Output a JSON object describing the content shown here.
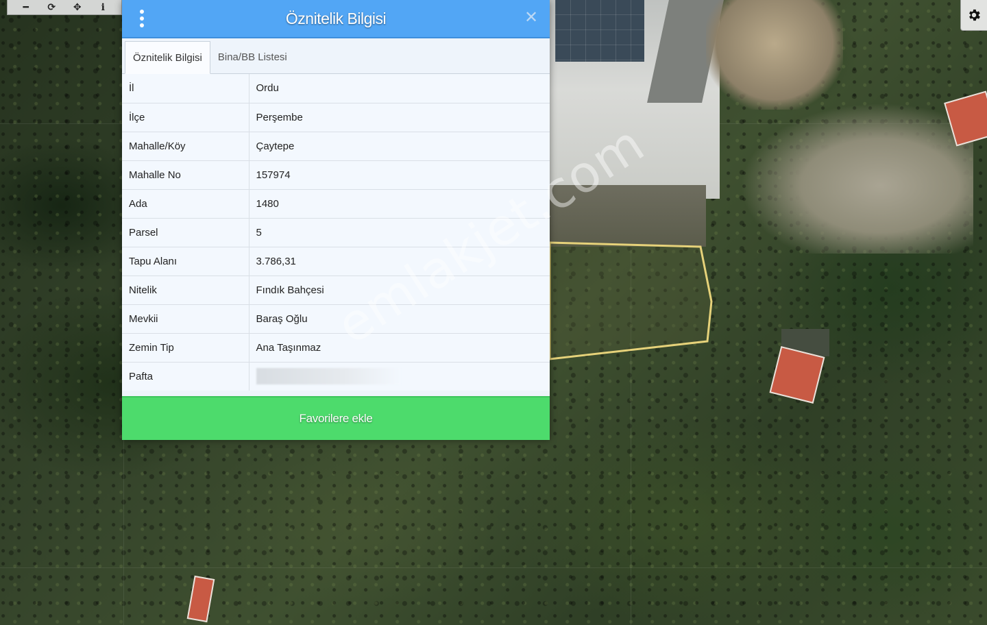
{
  "toolbar": {
    "items": [
      {
        "icon": "minus-icon",
        "glyph": "━"
      },
      {
        "icon": "refresh-icon",
        "glyph": "⟳"
      },
      {
        "icon": "pan-crosshair-icon",
        "glyph": "✥"
      },
      {
        "icon": "info-icon",
        "glyph": "i"
      }
    ],
    "settings_icon": "gear-icon"
  },
  "dialog": {
    "title": "Öznitelik Bilgisi",
    "menu_icon": "vertical-dots-icon",
    "close_icon": "close-icon",
    "tabs": [
      {
        "label": "Öznitelik Bilgisi",
        "active": true
      },
      {
        "label": "Bina/BB Listesi",
        "active": false
      }
    ],
    "rows": [
      {
        "key": "İl",
        "value": "Ordu"
      },
      {
        "key": "İlçe",
        "value": "Perşembe"
      },
      {
        "key": "Mahalle/Köy",
        "value": "Çaytepe"
      },
      {
        "key": "Mahalle No",
        "value": "157974"
      },
      {
        "key": "Ada",
        "value": "1480"
      },
      {
        "key": "Parsel",
        "value": "5"
      },
      {
        "key": "Tapu Alanı",
        "value": "3.786,31"
      },
      {
        "key": "Nitelik",
        "value": "Fındık Bahçesi"
      },
      {
        "key": "Mevkii",
        "value": "Baraş Oğlu"
      },
      {
        "key": "Zemin Tip",
        "value": "Ana Taşınmaz"
      },
      {
        "key": "Pafta",
        "value": ""
      }
    ],
    "favorite_button": "Favorilere ekle"
  },
  "watermark": "emlakjet.com",
  "colors": {
    "header": "#52a6f5",
    "favorite_button": "#4ddb6c",
    "parcel_outline": "#e6d27a"
  }
}
